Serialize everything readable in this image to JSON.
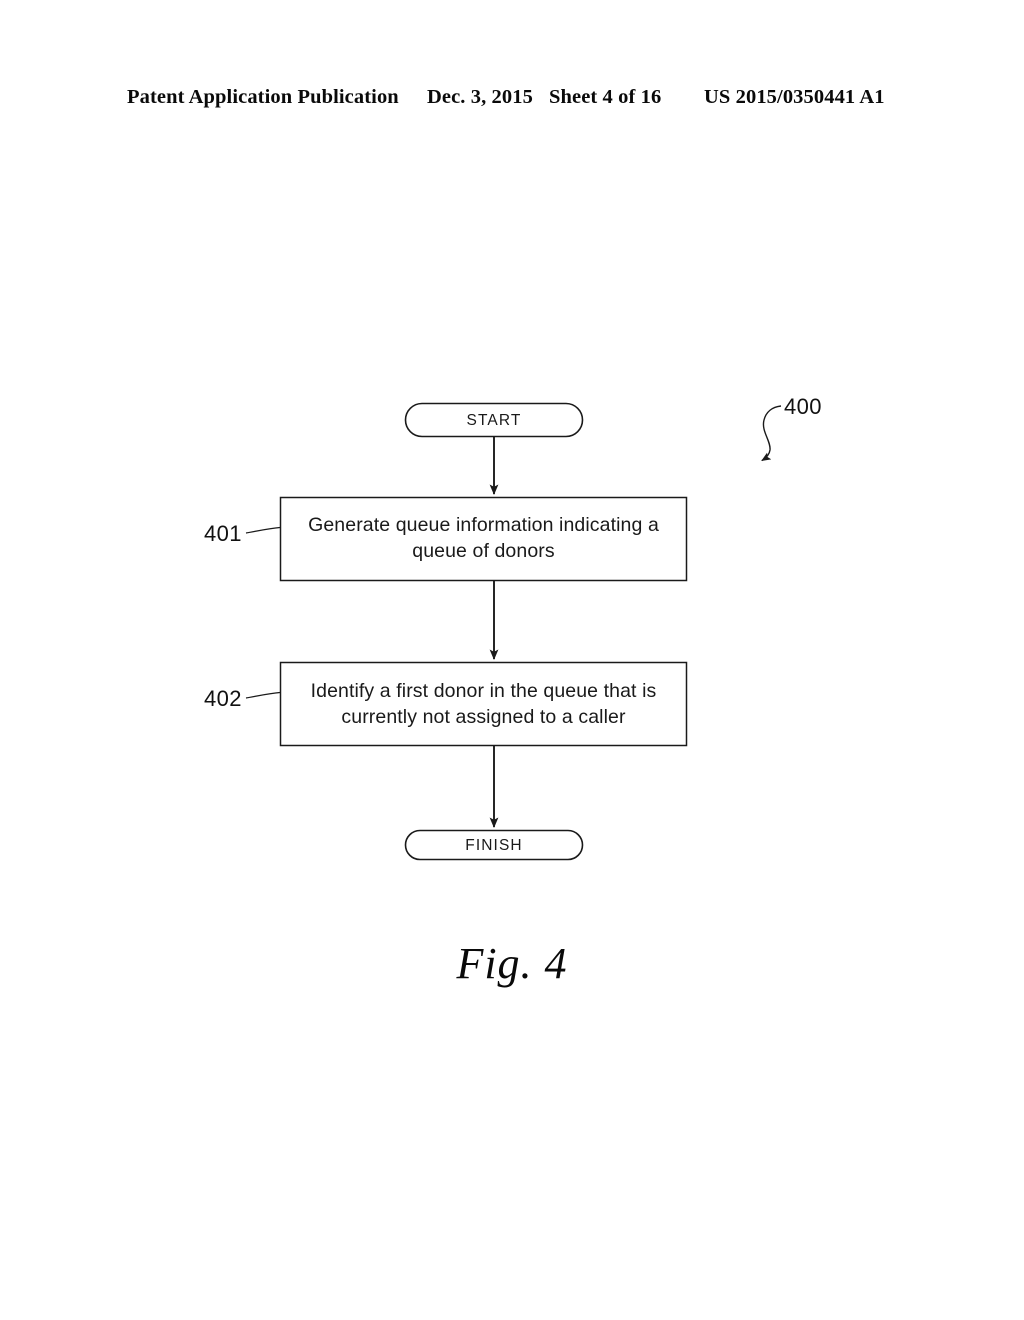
{
  "header": {
    "publication": "Patent Application Publication",
    "date": "Dec. 3, 2015",
    "sheet": "Sheet 4 of 16",
    "patent_number": "US 2015/0350441 A1"
  },
  "figure": {
    "caption": "Fig. 4",
    "diagram_reference": "400",
    "nodes": [
      {
        "id": "start",
        "type": "terminal",
        "label": "START",
        "reference": null
      },
      {
        "id": "step-401",
        "type": "process",
        "label": "Generate queue information indicating a queue of donors",
        "line1": "Generate queue information indicating a",
        "line2": "queue of donors",
        "reference": "401"
      },
      {
        "id": "step-402",
        "type": "process",
        "label": "Identify a first donor in the queue that is currently not assigned to a caller",
        "line1": "Identify a first donor in the queue that is",
        "line2": "currently not assigned to a caller",
        "reference": "402"
      },
      {
        "id": "finish",
        "type": "terminal",
        "label": "FINISH",
        "reference": null
      }
    ],
    "connectors": [
      {
        "from": "start",
        "to": "step-401",
        "arrow": "down"
      },
      {
        "from": "step-401",
        "to": "step-402",
        "arrow": "down"
      },
      {
        "from": "step-402",
        "to": "finish",
        "arrow": "down"
      }
    ],
    "colors": {
      "stroke": "#1a1a1a",
      "text": "#1a1a1a",
      "background": "#ffffff"
    }
  }
}
